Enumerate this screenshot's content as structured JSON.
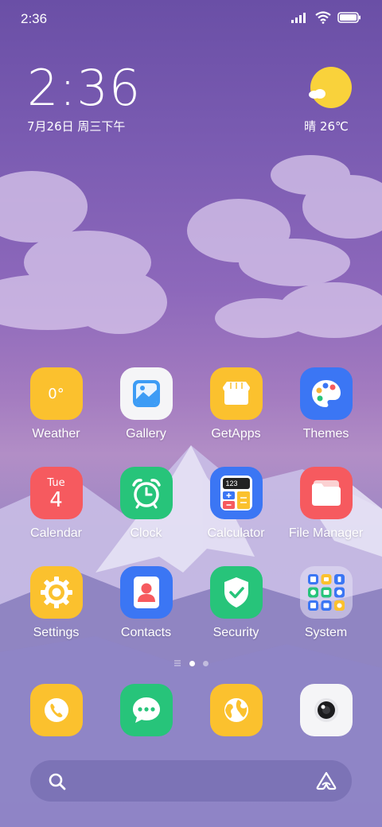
{
  "status_bar": {
    "time": "2:36"
  },
  "clock_widget": {
    "time": "2:36",
    "date": "7月26日 周三下午"
  },
  "weather_widget": {
    "text": "晴 26℃"
  },
  "apps": [
    {
      "label": "Weather",
      "icon_text": "0°"
    },
    {
      "label": "Gallery"
    },
    {
      "label": "GetApps"
    },
    {
      "label": "Themes"
    },
    {
      "label": "Calendar",
      "icon_day": "Tue",
      "icon_date": "4"
    },
    {
      "label": "Clock"
    },
    {
      "label": "Calculator",
      "icon_text": "123"
    },
    {
      "label": "File Manager"
    },
    {
      "label": "Settings"
    },
    {
      "label": "Contacts"
    },
    {
      "label": "Security"
    },
    {
      "label": "System"
    }
  ],
  "dock": [
    "Phone",
    "Messages",
    "Browser",
    "Camera"
  ],
  "page_indicator": {
    "pages": 2,
    "current": 1
  },
  "colors": {
    "yellow": "#fbc12e",
    "red": "#f65a5f",
    "green": "#27c47a",
    "blue": "#3b76f4"
  }
}
